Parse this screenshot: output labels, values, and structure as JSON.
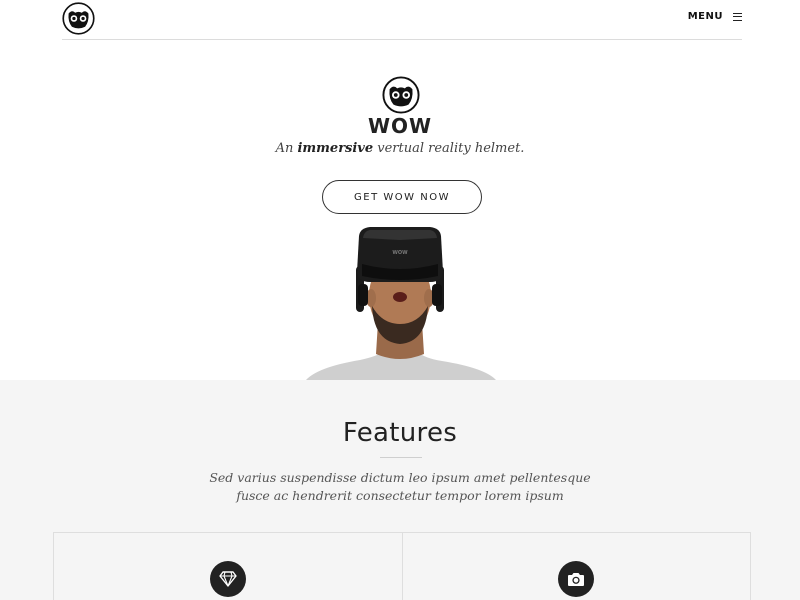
{
  "nav": {
    "logo_icon": "owl-logo-icon",
    "menu_label": "MENU",
    "menu_icon": "hamburger-icon"
  },
  "hero": {
    "logo_icon": "owl-logo-icon",
    "brand": "WOW",
    "tagline_before": "An ",
    "tagline_bold": "immersive",
    "tagline_after": " vertual reality helmet.",
    "cta_label": "GET WOW NOW",
    "image": "person-wearing-vr-headset",
    "headset_label": "WOW"
  },
  "features": {
    "title": "Features",
    "description_line1": "Sed varius suspendisse dictum leo ipsum amet pellentesque",
    "description_line2": "fusce ac hendrerit consectetur tempor lorem ipsum",
    "items": [
      {
        "icon": "diamond-icon"
      },
      {
        "icon": "camera-icon"
      }
    ]
  },
  "colors": {
    "hero_bg": "#ffffff",
    "features_bg": "#f5f5f5",
    "text_dark": "#222222",
    "border": "#dedede"
  }
}
